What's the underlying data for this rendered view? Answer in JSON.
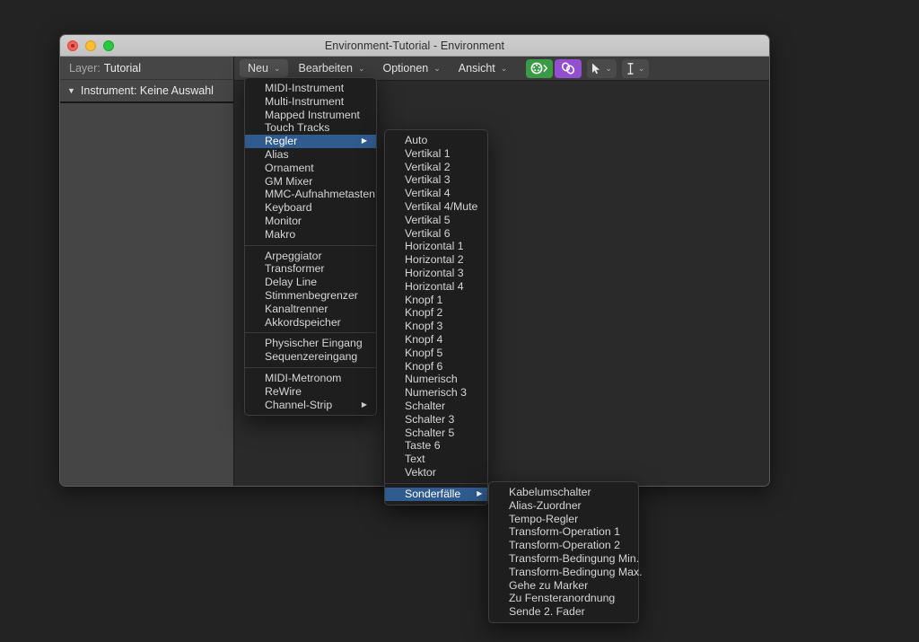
{
  "window": {
    "title": "Environment-Tutorial - Environment",
    "traffic_lights": [
      "close-button",
      "minimize-button",
      "zoom-button"
    ]
  },
  "inspector": {
    "layer_label": "Layer:",
    "layer_value": "Tutorial",
    "instrument_text": "Instrument: Keine Auswahl",
    "disclosure_glyph": "▼"
  },
  "toolbar": {
    "menus": [
      {
        "label": "Neu",
        "active": true
      },
      {
        "label": "Bearbeiten",
        "active": false
      },
      {
        "label": "Optionen",
        "active": false
      },
      {
        "label": "Ansicht",
        "active": false
      }
    ],
    "chevron_glyph": "⌄",
    "buttons": [
      {
        "name": "midi-in-button",
        "color": "#3a9a46"
      },
      {
        "name": "cable-link-button",
        "color": "#9250d0"
      }
    ],
    "tools": [
      {
        "name": "pointer-tool",
        "glyph": "➤"
      },
      {
        "name": "text-tool",
        "glyph": "I"
      }
    ]
  },
  "menu_new": {
    "groups": [
      {
        "items": [
          {
            "label": "MIDI-Instrument",
            "selected": false,
            "submenu": false
          },
          {
            "label": "Multi-Instrument",
            "selected": false,
            "submenu": false
          },
          {
            "label": "Mapped Instrument",
            "selected": false,
            "submenu": false
          },
          {
            "label": "Touch Tracks",
            "selected": false,
            "submenu": false
          },
          {
            "label": "Regler",
            "selected": true,
            "submenu": true
          },
          {
            "label": "Alias",
            "selected": false,
            "submenu": false
          },
          {
            "label": "Ornament",
            "selected": false,
            "submenu": false
          },
          {
            "label": "GM Mixer",
            "selected": false,
            "submenu": false
          },
          {
            "label": "MMC-Aufnahmetasten",
            "selected": false,
            "submenu": false
          },
          {
            "label": "Keyboard",
            "selected": false,
            "submenu": false
          },
          {
            "label": "Monitor",
            "selected": false,
            "submenu": false
          },
          {
            "label": "Makro",
            "selected": false,
            "submenu": false
          }
        ]
      },
      {
        "items": [
          {
            "label": "Arpeggiator",
            "selected": false,
            "submenu": false
          },
          {
            "label": "Transformer",
            "selected": false,
            "submenu": false
          },
          {
            "label": "Delay Line",
            "selected": false,
            "submenu": false
          },
          {
            "label": "Stimmenbegrenzer",
            "selected": false,
            "submenu": false
          },
          {
            "label": "Kanaltrenner",
            "selected": false,
            "submenu": false
          },
          {
            "label": "Akkordspeicher",
            "selected": false,
            "submenu": false
          }
        ]
      },
      {
        "items": [
          {
            "label": "Physischer Eingang",
            "selected": false,
            "submenu": false
          },
          {
            "label": "Sequenzereingang",
            "selected": false,
            "submenu": false
          }
        ]
      },
      {
        "items": [
          {
            "label": "MIDI-Metronom",
            "selected": false,
            "submenu": false
          },
          {
            "label": "ReWire",
            "selected": false,
            "submenu": false
          },
          {
            "label": "Channel-Strip",
            "selected": false,
            "submenu": true
          }
        ]
      }
    ]
  },
  "menu_regler": {
    "groups": [
      {
        "items": [
          {
            "label": "Auto",
            "selected": false,
            "submenu": false
          },
          {
            "label": "Vertikal 1",
            "selected": false,
            "submenu": false
          },
          {
            "label": "Vertikal 2",
            "selected": false,
            "submenu": false
          },
          {
            "label": "Vertikal 3",
            "selected": false,
            "submenu": false
          },
          {
            "label": "Vertikal 4",
            "selected": false,
            "submenu": false
          },
          {
            "label": "Vertikal 4/Mute",
            "selected": false,
            "submenu": false
          },
          {
            "label": "Vertikal 5",
            "selected": false,
            "submenu": false
          },
          {
            "label": "Vertikal 6",
            "selected": false,
            "submenu": false
          },
          {
            "label": "Horizontal 1",
            "selected": false,
            "submenu": false
          },
          {
            "label": "Horizontal 2",
            "selected": false,
            "submenu": false
          },
          {
            "label": "Horizontal 3",
            "selected": false,
            "submenu": false
          },
          {
            "label": "Horizontal 4",
            "selected": false,
            "submenu": false
          },
          {
            "label": "Knopf 1",
            "selected": false,
            "submenu": false
          },
          {
            "label": "Knopf 2",
            "selected": false,
            "submenu": false
          },
          {
            "label": "Knopf 3",
            "selected": false,
            "submenu": false
          },
          {
            "label": "Knopf 4",
            "selected": false,
            "submenu": false
          },
          {
            "label": "Knopf 5",
            "selected": false,
            "submenu": false
          },
          {
            "label": "Knopf 6",
            "selected": false,
            "submenu": false
          },
          {
            "label": "Numerisch",
            "selected": false,
            "submenu": false
          },
          {
            "label": "Numerisch 3",
            "selected": false,
            "submenu": false
          },
          {
            "label": "Schalter",
            "selected": false,
            "submenu": false
          },
          {
            "label": "Schalter 3",
            "selected": false,
            "submenu": false
          },
          {
            "label": "Schalter 5",
            "selected": false,
            "submenu": false
          },
          {
            "label": "Taste 6",
            "selected": false,
            "submenu": false
          },
          {
            "label": "Text",
            "selected": false,
            "submenu": false
          },
          {
            "label": "Vektor",
            "selected": false,
            "submenu": false
          }
        ]
      },
      {
        "items": [
          {
            "label": "Sonderfälle",
            "selected": true,
            "submenu": true
          }
        ]
      }
    ]
  },
  "menu_special": {
    "groups": [
      {
        "items": [
          {
            "label": "Kabelumschalter",
            "selected": false,
            "submenu": false
          },
          {
            "label": "Alias-Zuordner",
            "selected": false,
            "submenu": false
          },
          {
            "label": "Tempo-Regler",
            "selected": false,
            "submenu": false
          },
          {
            "label": "Transform-Operation 1",
            "selected": false,
            "submenu": false
          },
          {
            "label": "Transform-Operation 2",
            "selected": false,
            "submenu": false
          },
          {
            "label": "Transform-Bedingung Min.",
            "selected": false,
            "submenu": false
          },
          {
            "label": "Transform-Bedingung Max.",
            "selected": false,
            "submenu": false
          },
          {
            "label": "Gehe zu Marker",
            "selected": false,
            "submenu": false
          },
          {
            "label": "Zu Fensteranordnung",
            "selected": false,
            "submenu": false
          },
          {
            "label": "Sende 2. Fader",
            "selected": false,
            "submenu": false
          }
        ]
      }
    ]
  },
  "colors": {
    "desktop": "#232323",
    "highlight": "#2f5b8f",
    "menu_bg": "#1e1e1e",
    "titlebar": "#c8c8c8",
    "green_button": "#3a9a46",
    "purple_button": "#9250d0"
  }
}
